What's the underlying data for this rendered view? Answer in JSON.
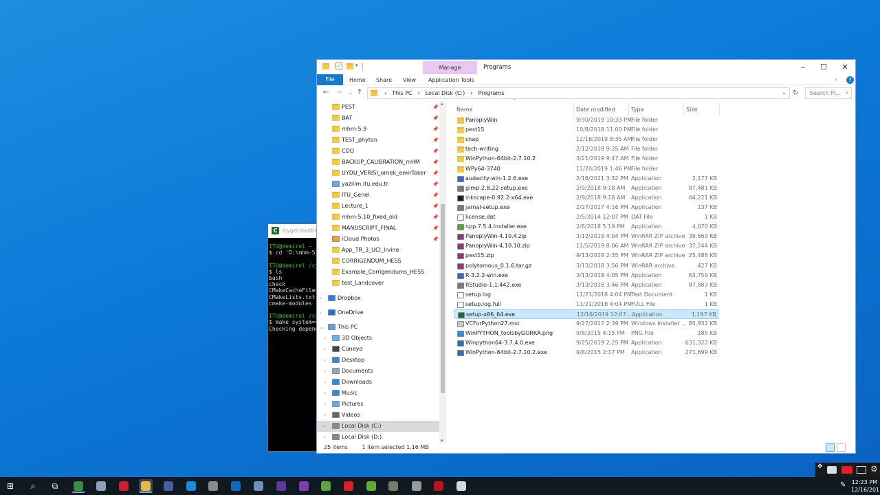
{
  "terminal": {
    "title": "/cygdrive/d/m",
    "lines": [
      {
        "t": "ITU@demirel ~",
        "c": "tg"
      },
      {
        "t": "$ cd 'D:\\mhm-5.",
        "c": ""
      },
      {
        "t": "",
        "c": ""
      },
      {
        "t": "ITU@demirel /cy",
        "c": "tg"
      },
      {
        "t": "$ ls",
        "c": ""
      },
      {
        "t": "bash",
        "c": ""
      },
      {
        "t": "check",
        "c": ""
      },
      {
        "t": "CMakeCacheFiles",
        "c": ""
      },
      {
        "t": "CMakeLists.txt",
        "c": ""
      },
      {
        "t": "cmake-modules",
        "c": ""
      },
      {
        "t": "",
        "c": ""
      },
      {
        "t": "ITU@demirel /cy",
        "c": "tg"
      },
      {
        "t": "$ make system=c",
        "c": ""
      },
      {
        "t": "Checking depend",
        "c": ""
      }
    ]
  },
  "explorer": {
    "title": "Programs",
    "manage_tab": "Manage",
    "app_tools_tab": "Application Tools",
    "ribbon": {
      "file": "File",
      "home": "Home",
      "share": "Share",
      "view": "View"
    },
    "address": {
      "seg1": "This PC",
      "seg2": "Local Disk (C:)",
      "seg3": "Programs"
    },
    "search_placeholder": "Search Pr...",
    "columns": {
      "name": "Name",
      "date": "Date modified",
      "type": "Type",
      "size": "Size"
    },
    "nav_items": [
      {
        "label": "PEST",
        "icon": "folder",
        "pin": true,
        "indent": 1
      },
      {
        "label": "BAT",
        "icon": "sync-folder",
        "pin": true,
        "indent": 1
      },
      {
        "label": "mhm-5.9",
        "icon": "folder",
        "pin": true,
        "indent": 1
      },
      {
        "label": "TEST_phyton",
        "icon": "folder",
        "pin": true,
        "indent": 1
      },
      {
        "label": "CDO",
        "icon": "folder",
        "pin": true,
        "indent": 1
      },
      {
        "label": "BACKUP_CALIBRATION_mHM",
        "icon": "folder",
        "pin": true,
        "indent": 1
      },
      {
        "label": "UYDU_VERISI_ornek_emirToker",
        "icon": "folder",
        "pin": true,
        "indent": 1
      },
      {
        "label": "yazilim.itu.edu.tr",
        "icon": "network",
        "pin": true,
        "indent": 1
      },
      {
        "label": "ITU_Genel",
        "icon": "sync-folder",
        "pin": true,
        "indent": 1
      },
      {
        "label": "Lecture_1",
        "icon": "folder",
        "pin": true,
        "indent": 1
      },
      {
        "label": "mhm-5.10_fixed_old",
        "icon": "folder",
        "pin": true,
        "indent": 1
      },
      {
        "label": "MANUSCRIPT_FINAL",
        "icon": "folder",
        "pin": true,
        "indent": 1
      },
      {
        "label": "iCloud Photos",
        "icon": "icloud",
        "pin": true,
        "indent": 1
      },
      {
        "label": "App_TR_3_UCI_Irvine",
        "icon": "folder",
        "pin": false,
        "indent": 1
      },
      {
        "label": "CORRIGENDUM_HESS",
        "icon": "folder",
        "pin": false,
        "indent": 1
      },
      {
        "label": "Example_Corrigendums_HESS",
        "icon": "folder",
        "pin": false,
        "indent": 1
      },
      {
        "label": "test_Landcover",
        "icon": "folder",
        "pin": false,
        "indent": 1
      },
      {
        "label": "Dropbox",
        "icon": "dropbox",
        "pin": false,
        "indent": 0,
        "gap": 6
      },
      {
        "label": "OneDrive",
        "icon": "onedrive",
        "pin": false,
        "indent": 0,
        "gap": 5
      },
      {
        "label": "This PC",
        "icon": "pc",
        "pin": false,
        "indent": 0,
        "gap": 5,
        "expanded": true
      },
      {
        "label": "3D Objects",
        "icon": "3d",
        "pin": false,
        "indent": 1
      },
      {
        "label": "Cüneyd",
        "icon": "user",
        "pin": false,
        "indent": 1
      },
      {
        "label": "Desktop",
        "icon": "desktop",
        "pin": false,
        "indent": 1
      },
      {
        "label": "Documents",
        "icon": "documents",
        "pin": false,
        "indent": 1
      },
      {
        "label": "Downloads",
        "icon": "downloads",
        "pin": false,
        "indent": 1
      },
      {
        "label": "Music",
        "icon": "music",
        "pin": false,
        "indent": 1
      },
      {
        "label": "Pictures",
        "icon": "pictures",
        "pin": false,
        "indent": 1
      },
      {
        "label": "Videos",
        "icon": "videos",
        "pin": false,
        "indent": 1
      },
      {
        "label": "Local Disk (C:)",
        "icon": "disk",
        "pin": false,
        "indent": 1,
        "selected": true
      },
      {
        "label": "Local Disk (D:)",
        "icon": "disk",
        "pin": false,
        "indent": 1
      }
    ],
    "files": [
      {
        "name": "PanoplyWin",
        "date": "9/30/2019 10:33 PM",
        "type": "File folder",
        "size": "",
        "icon": "folder"
      },
      {
        "name": "pest15",
        "date": "10/8/2018 11:00 PM",
        "type": "File folder",
        "size": "",
        "icon": "folder"
      },
      {
        "name": "snap",
        "date": "12/16/2019 8:35 AM",
        "type": "File folder",
        "size": "",
        "icon": "folder"
      },
      {
        "name": "tech-writing",
        "date": "2/12/2018 9:35 AM",
        "type": "File folder",
        "size": "",
        "icon": "folder"
      },
      {
        "name": "WinPython-64bit-2.7.10.2",
        "date": "3/21/2019 9:47 AM",
        "type": "File folder",
        "size": "",
        "icon": "folder"
      },
      {
        "name": "WPy64-3740",
        "date": "11/20/2019 1:46 PM",
        "type": "File folder",
        "size": "",
        "icon": "folder"
      },
      {
        "name": "audacity-win-1.2.6.exe",
        "date": "2/16/2011 3:32 PM",
        "type": "Application",
        "size": "2,177 KB",
        "icon": "exe-blue"
      },
      {
        "name": "gimp-2.8.22-setup.exe",
        "date": "2/9/2018 9:18 AM",
        "type": "Application",
        "size": "87,481 KB",
        "icon": "exe-gray"
      },
      {
        "name": "inkscape-0.92.2-x64.exe",
        "date": "2/9/2018 9:18 AM",
        "type": "Application",
        "size": "64,221 KB",
        "icon": "exe-black"
      },
      {
        "name": "jarnal-setup.exe",
        "date": "2/27/2017 4:16 PM",
        "type": "Application",
        "size": "137 KB",
        "icon": "exe-gray"
      },
      {
        "name": "license.dat",
        "date": "2/5/2014 12:07 PM",
        "type": "DAT File",
        "size": "1 KB",
        "icon": "doc"
      },
      {
        "name": "npp.7.5.4.Installer.exe",
        "date": "2/8/2018 5:19 PM",
        "type": "Application",
        "size": "4,070 KB",
        "icon": "exe-green"
      },
      {
        "name": "PanoplyWin-4.10.4.zip",
        "date": "3/12/2019 4:04 PM",
        "type": "WinRAR ZIP archive",
        "size": "39,669 KB",
        "icon": "rar"
      },
      {
        "name": "PanoplyWin-4.10.10.zip",
        "date": "11/5/2019 8:06 AM",
        "type": "WinRAR ZIP archive",
        "size": "37,244 KB",
        "icon": "rar"
      },
      {
        "name": "pest15.zip",
        "date": "9/13/2018 2:35 PM",
        "type": "WinRAR ZIP archive",
        "size": "25,488 KB",
        "icon": "rar"
      },
      {
        "name": "polytomous_0.1.6.tar.gz",
        "date": "3/13/2018 3:56 PM",
        "type": "WinRAR archive",
        "size": "427 KB",
        "icon": "rar"
      },
      {
        "name": "R-3.2.2-win.exe",
        "date": "3/13/2018 4:05 PM",
        "type": "Application",
        "size": "63,759 KB",
        "icon": "exe-blue"
      },
      {
        "name": "RStudio-1.1.442.exe",
        "date": "3/13/2018 3:46 PM",
        "type": "Application",
        "size": "87,883 KB",
        "icon": "exe-gray"
      },
      {
        "name": "setup.log",
        "date": "11/21/2018 4:04 PM",
        "type": "Text Document",
        "size": "1 KB",
        "icon": "doc"
      },
      {
        "name": "setup.log.full",
        "date": "11/21/2018 4:04 PM",
        "type": "FULL File",
        "size": "1 KB",
        "icon": "doc"
      },
      {
        "name": "setup-x86_64.exe",
        "date": "12/16/2019 12:07 ...",
        "type": "Application",
        "size": "1,197 KB",
        "icon": "exe-cyg",
        "selected": true
      },
      {
        "name": "VCForPython27.msi",
        "date": "9/27/2017 2:39 PM",
        "type": "Windows Installer ...",
        "size": "85,932 KB",
        "icon": "msi"
      },
      {
        "name": "WinPYTHON_toolsbyGORKA.png",
        "date": "9/8/2015 4:15 PM",
        "type": "PNG File",
        "size": "185 KB",
        "icon": "img"
      },
      {
        "name": "Winpython64-3.7.4.0.exe",
        "date": "9/25/2019 2:25 PM",
        "type": "Application",
        "size": "631,322 KB",
        "icon": "exe-blue"
      },
      {
        "name": "WinPython-64bit-2.7.10.2.exe",
        "date": "9/8/2015 2:17 PM",
        "type": "Application",
        "size": "271,699 KB",
        "icon": "exe-blue"
      }
    ],
    "status": {
      "count": "25 items",
      "selected": "1 item selected  1.16 MB"
    }
  },
  "taskbar": {
    "time": "12:23 PM",
    "date": "12/16/201",
    "icons": [
      "windows-start-icon",
      "search-icon",
      "task-view-icon",
      "cygwin-terminal-icon",
      "app-icon",
      "mendeley-icon",
      "file-explorer-icon",
      "remote-desktop-icon",
      "teamviewer-icon",
      "app-icon",
      "outlook-icon",
      "r-icon",
      "app-icon",
      "app-icon",
      "notepad-plus-icon",
      "opera-icon",
      "qgis-icon",
      "app-icon",
      "app-icon",
      "acrobat-icon",
      "monitor-icon"
    ],
    "colors": [
      "#ffffff",
      "#ffffff",
      "#ffffff",
      "#3c8a45",
      "#8da0b8",
      "#c8202f",
      "#e8b74a",
      "#4c5a9e",
      "#1c8adb",
      "#8a8a8a",
      "#0f6cbd",
      "#6f8fbf",
      "#5b3a9e",
      "#7b3fb5",
      "#5aa53f",
      "#d8222a",
      "#5fae2f",
      "#7a7a6a",
      "#9a9a9a",
      "#c1121f",
      "#cfd8e3"
    ]
  }
}
